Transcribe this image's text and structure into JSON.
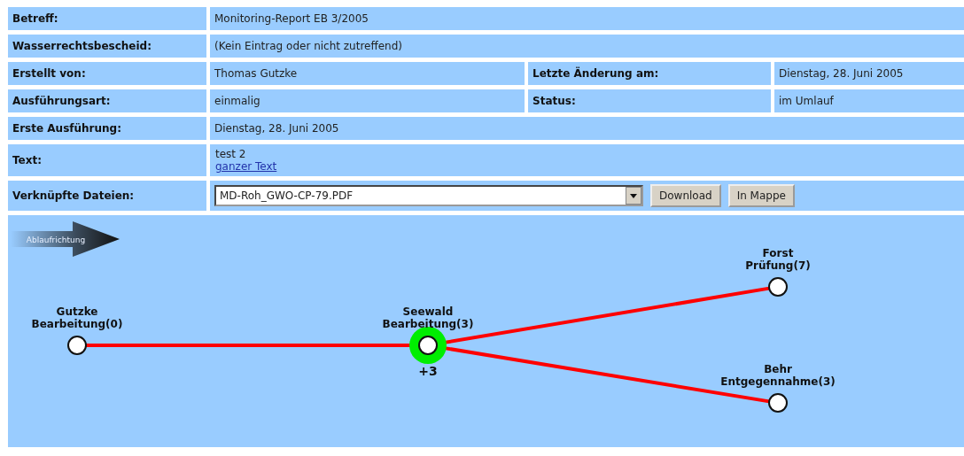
{
  "details": [
    {
      "kind": "single",
      "label": "Betreff:",
      "value": "Monitoring-Report EB 3/2005"
    },
    {
      "kind": "single",
      "label": "Wasserrechtsbescheid:",
      "value": "(Kein Eintrag oder nicht zutreffend)"
    },
    {
      "kind": "double",
      "label": "Erstellt von:",
      "value": "Thomas Gutzke",
      "label_2": "Letzte Änderung am:",
      "value_2": "Dienstag, 28. Juni 2005"
    },
    {
      "kind": "double",
      "label": "Ausführungsart:",
      "value": "einmalig",
      "label_2": "Status:",
      "value_2": "im Umlauf"
    },
    {
      "kind": "single",
      "label": "Erste Ausführung:",
      "value": "Dienstag, 28. Juni 2005"
    },
    {
      "kind": "text",
      "label": "Text:",
      "value": "test 2",
      "link": "ganzer Text"
    },
    {
      "kind": "files",
      "label": "Verknüpfte Dateien:",
      "value": "MD-Roh_GWO-CP-79.PDF",
      "buttons": [
        "Download",
        "In Mappe"
      ]
    }
  ],
  "workflow": {
    "direction_label": "Ablaufrichtung",
    "nodes": [
      {
        "name": "Gutzke",
        "step": "Bearbeitung(0)",
        "current": false
      },
      {
        "name": "Seewald",
        "step": "Bearbeitung(3)",
        "current": true,
        "badge": "+3"
      },
      {
        "name": "Forst",
        "step": "Prüfung(7)",
        "current": false
      },
      {
        "name": "Behr",
        "step": "Entgegennahme(3)",
        "current": false
      }
    ]
  }
}
